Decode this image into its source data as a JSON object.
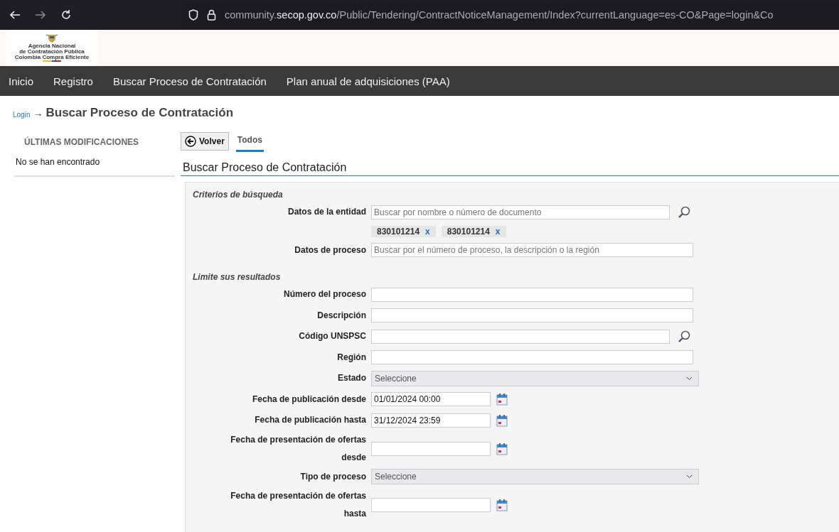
{
  "browser": {
    "url_prefix": "community.",
    "url_domain": "secop.gov.co",
    "url_path": "/Public/Tendering/ContractNoticeManagement/Index?currentLanguage=es-CO&Page=login&Co"
  },
  "logo": {
    "lines": [
      "Agencia Nacional",
      "de Contratación Pública",
      "Colombia Compra Eficiente"
    ]
  },
  "nav": [
    "Inicio",
    "Registro",
    "Buscar Proceso de Contratación",
    "Plan anual de adquisiciones (PAA)"
  ],
  "breadcrumb": {
    "link": "Login",
    "arrow": "→",
    "current": "Buscar Proceso de Contratación"
  },
  "sidebar": {
    "title": "ÚLTIMAS MODIFICACIONES",
    "empty": "No se han encontrado"
  },
  "back_button": "Volver",
  "tabs": [
    {
      "label": "Todos",
      "selected": true
    }
  ],
  "section_title": "Buscar Proceso de Contratación",
  "groups": [
    {
      "title": "Criterios de búsqueda",
      "rows": [
        {
          "label": "Datos de la entidad",
          "kind": "search",
          "placeholder": "Buscar por nombre o número de documento",
          "chips": [
            {
              "text": "830101214",
              "remove": "x"
            },
            {
              "text": "830101214",
              "remove": "x"
            }
          ]
        },
        {
          "label": "Datos de proceso",
          "kind": "text",
          "placeholder": "Buscar por el número de proceso, la descripción o la región"
        }
      ]
    },
    {
      "title": "Limite sus resultados",
      "rows": [
        {
          "label": "Número del proceso",
          "kind": "text"
        },
        {
          "label": "Descripción",
          "kind": "text"
        },
        {
          "label": "Código UNSPSC",
          "kind": "search"
        },
        {
          "label": "Región",
          "kind": "text"
        },
        {
          "label": "Estado",
          "kind": "select",
          "value": "Seleccione"
        },
        {
          "label": "Fecha de publicación desde",
          "kind": "date",
          "value": "01/01/2024 00:00"
        },
        {
          "label": "Fecha de publicación hasta",
          "kind": "date",
          "value": "31/12/2024 23:59"
        },
        {
          "label": "Fecha de presentación de ofertas desde",
          "kind": "date"
        },
        {
          "label": "Tipo de proceso",
          "kind": "select",
          "value": "Seleccione"
        },
        {
          "label": "Fecha de presentación de ofertas hasta",
          "kind": "date"
        }
      ]
    }
  ]
}
